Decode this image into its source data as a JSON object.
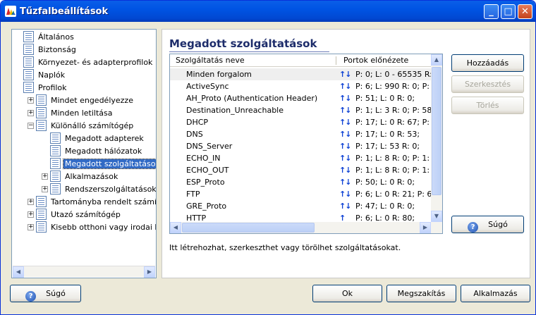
{
  "window": {
    "title": "Tűzfalbeállítások"
  },
  "titlebar_buttons": {
    "minimize": "_",
    "maximize": "□",
    "close": "✕"
  },
  "tree": {
    "items": [
      {
        "label": "Általános",
        "level": 0,
        "expander": ""
      },
      {
        "label": "Biztonság",
        "level": 0,
        "expander": ""
      },
      {
        "label": "Környezet- és adapterprofilok",
        "level": 0,
        "expander": ""
      },
      {
        "label": "Naplók",
        "level": 0,
        "expander": ""
      },
      {
        "label": "Profilok",
        "level": 0,
        "expander": ""
      },
      {
        "label": "Mindet engedélyezze",
        "level": 1,
        "expander": "+"
      },
      {
        "label": "Minden letiltása",
        "level": 1,
        "expander": "+"
      },
      {
        "label": "Különálló számítógép",
        "level": 1,
        "expander": "−"
      },
      {
        "label": "Megadott adapterek",
        "level": 2,
        "expander": ""
      },
      {
        "label": "Megadott hálózatok",
        "level": 2,
        "expander": ""
      },
      {
        "label": "Megadott szolgáltatások",
        "level": 2,
        "expander": "",
        "selected": true
      },
      {
        "label": "Alkalmazások",
        "level": 2,
        "expander": "+"
      },
      {
        "label": "Rendszerszolgáltatások",
        "level": 2,
        "expander": "+"
      },
      {
        "label": "Tartományba rendelt számítógép",
        "level": 1,
        "expander": "+"
      },
      {
        "label": "Utazó számítógép",
        "level": 1,
        "expander": "+"
      },
      {
        "label": "Kisebb otthoni vagy irodai hálózat",
        "level": 1,
        "expander": "+"
      }
    ]
  },
  "panel": {
    "title": "Megadott szolgáltatások",
    "columns": {
      "name": "Szolgáltatás neve",
      "ports": "Portok előnézete"
    },
    "rows": [
      {
        "name": "Minden forgalom",
        "arrows": "↑↓",
        "ports": "P: 0;  L: 0 - 65535 R: 0"
      },
      {
        "name": "ActiveSync",
        "arrows": "↑↓",
        "ports": "P: 6;  L: 990 R: 0; P: 6"
      },
      {
        "name": "AH_Proto (Authentication Header)",
        "arrows": "↑↓",
        "ports": "P: 51;  L: 0 R: 0;"
      },
      {
        "name": "Destination_Unreachable",
        "arrows": "↑↓",
        "ports": "P: 1;  L: 3 R: 0; P: 58:"
      },
      {
        "name": "DHCP",
        "arrows": "↑↓",
        "ports": "P: 17;  L: 0 R: 67; P: 1"
      },
      {
        "name": "DNS",
        "arrows": "↑↓",
        "ports": "P: 17;  L: 0 R: 53;"
      },
      {
        "name": "DNS_Server",
        "arrows": "↑↓",
        "ports": "P: 17;  L: 53 R: 0;"
      },
      {
        "name": "ECHO_IN",
        "arrows": "↑↓",
        "ports": "P: 1;  L: 8 R: 0; P: 1:  I"
      },
      {
        "name": "ECHO_OUT",
        "arrows": "↑↓",
        "ports": "P: 1;  L: 8 R: 0; P: 1:  I"
      },
      {
        "name": "ESP_Proto",
        "arrows": "↑↓",
        "ports": "P: 50;  L: 0 R: 0;"
      },
      {
        "name": "FTP",
        "arrows": "↑↓",
        "ports": "P: 6;  L: 0 R: 21; P: 6:"
      },
      {
        "name": "GRE_Proto",
        "arrows": "↑↓",
        "ports": "P: 47;  L: 0 R: 0;"
      },
      {
        "name": "HTTP",
        "arrows": "↑",
        "ports": "P: 6;  L: 0 R: 80;"
      }
    ],
    "description": "Itt létrehozhat, szerkeszthet vagy törölhet szolgáltatásokat."
  },
  "side_buttons": {
    "add": "Hozzáadás",
    "edit": "Szerkesztés",
    "delete": "Törlés",
    "help": "Súgó"
  },
  "bottom_buttons": {
    "help": "Súgó",
    "ok": "Ok",
    "cancel": "Megszakítás",
    "apply": "Alkalmazás"
  },
  "colors": {
    "selection": "#316ac5",
    "title_text": "#1e2d6b",
    "arrows": "#0a3fd4"
  }
}
